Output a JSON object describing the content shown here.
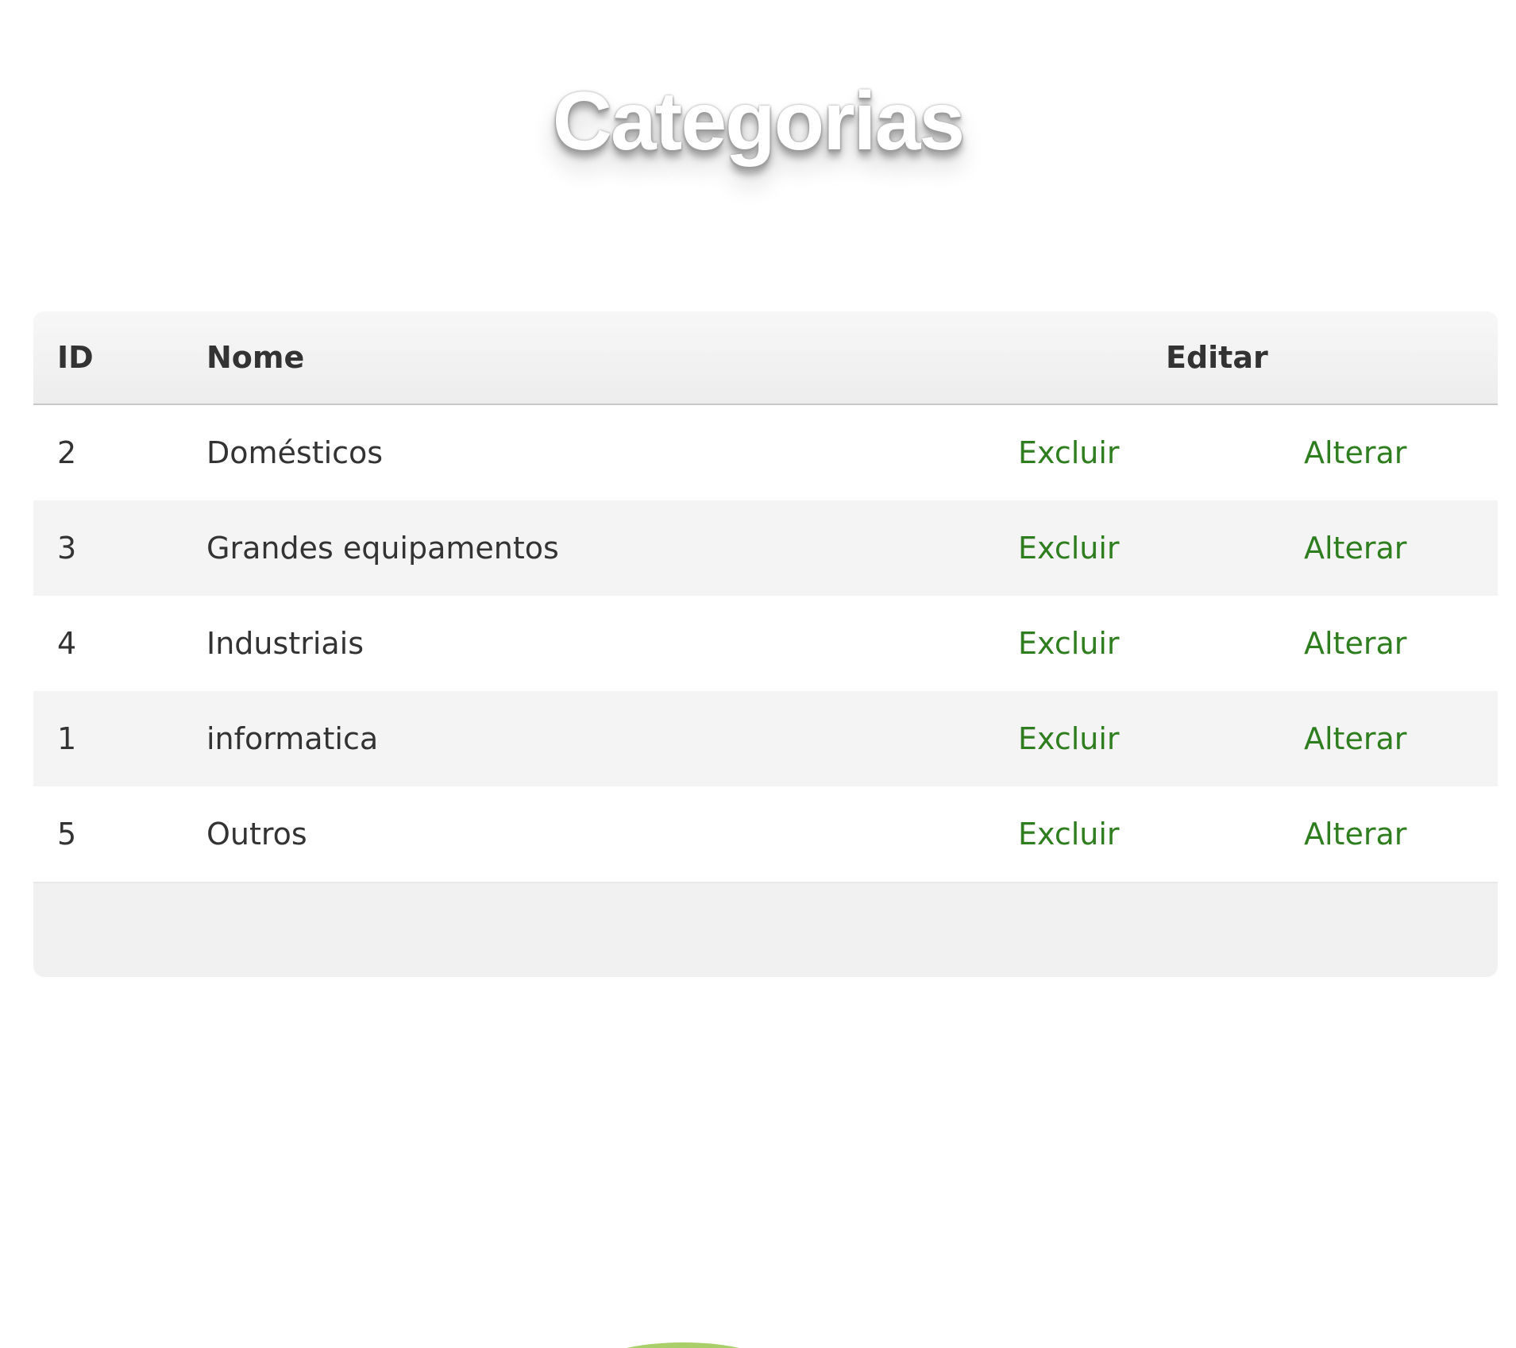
{
  "page": {
    "title": "Categorias"
  },
  "table": {
    "headers": {
      "id": "ID",
      "nome": "Nome",
      "editar": "Editar"
    },
    "rows": [
      {
        "id": "2",
        "nome": "Domésticos",
        "excluir": "Excluir",
        "alterar": "Alterar"
      },
      {
        "id": "3",
        "nome": "Grandes equipamentos",
        "excluir": "Excluir",
        "alterar": "Alterar"
      },
      {
        "id": "4",
        "nome": "Industriais",
        "excluir": "Excluir",
        "alterar": "Alterar"
      },
      {
        "id": "1",
        "nome": "informatica",
        "excluir": "Excluir",
        "alterar": "Alterar"
      },
      {
        "id": "5",
        "nome": "Outros",
        "excluir": "Excluir",
        "alterar": "Alterar"
      }
    ]
  },
  "colors": {
    "link": "#2e7d1e",
    "text": "#333333",
    "accent_arc": "#a8cf6a"
  }
}
